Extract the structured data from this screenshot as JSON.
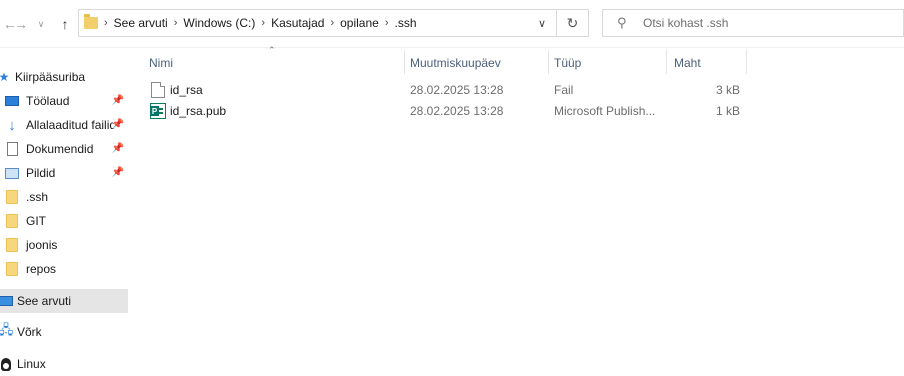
{
  "address_bar": {
    "breadcrumbs": [
      "See arvuti",
      "Windows (C:)",
      "Kasutajad",
      "opilane",
      ".ssh"
    ]
  },
  "search": {
    "placeholder": "Otsi kohast .ssh"
  },
  "sidebar": {
    "items": [
      {
        "label": "Kiirpääsuriba",
        "icon": "star-icon"
      },
      {
        "label": "Töölaud",
        "icon": "desktop-icon",
        "pinned": true
      },
      {
        "label": "Allalaaditud failid",
        "icon": "download-arrow-icon",
        "pinned": true
      },
      {
        "label": "Dokumendid",
        "icon": "documents-icon",
        "pinned": true
      },
      {
        "label": "Pildid",
        "icon": "pictures-icon",
        "pinned": true
      },
      {
        "label": ".ssh",
        "icon": "folder-icon"
      },
      {
        "label": "GIT",
        "icon": "folder-icon"
      },
      {
        "label": "joonis",
        "icon": "folder-icon"
      },
      {
        "label": "repos",
        "icon": "folder-icon"
      },
      {
        "label": "See arvuti",
        "icon": "computer-icon",
        "selected": true
      },
      {
        "label": "Võrk",
        "icon": "network-icon"
      },
      {
        "label": "Linux",
        "icon": "linux-penguin-icon"
      }
    ]
  },
  "columns": {
    "name": "Nimi",
    "modified": "Muutmiskuupäev",
    "type": "Tüüp",
    "size": "Maht"
  },
  "files": [
    {
      "name": "id_rsa",
      "modified": "28.02.2025 13:28",
      "type": "Fail",
      "size": "3 kB",
      "icon": "generic-file-icon"
    },
    {
      "name": "id_rsa.pub",
      "modified": "28.02.2025 13:28",
      "type": "Microsoft Publish...",
      "size": "1 kB",
      "icon": "publisher-file-icon"
    }
  ],
  "colors": {
    "selected_bg": "#e5e5e5",
    "header_text": "#4c607a",
    "accent_blue": "#1a73d9"
  }
}
